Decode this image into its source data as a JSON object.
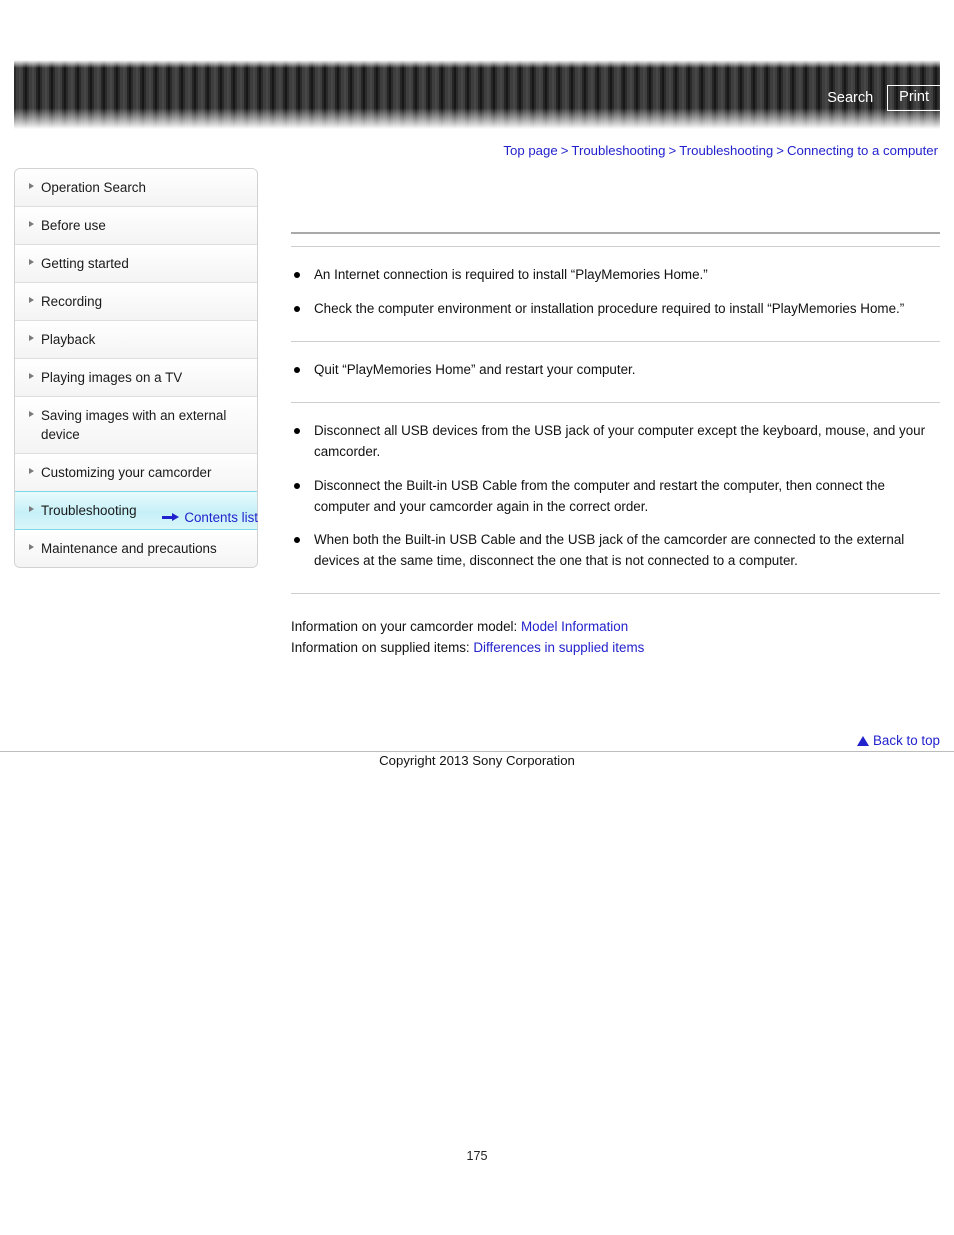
{
  "header": {
    "search_label": "Search",
    "print_label": "Print",
    "search_icon": "search-icon",
    "print_icon": "print-icon"
  },
  "breadcrumb": {
    "separator": ">",
    "items": [
      {
        "label": "Top page"
      },
      {
        "label": "Troubleshooting"
      },
      {
        "label": "Troubleshooting"
      },
      {
        "label": "Connecting to a computer"
      }
    ]
  },
  "sidebar": {
    "items": [
      {
        "label": "Operation Search",
        "active": false
      },
      {
        "label": "Before use",
        "active": false
      },
      {
        "label": "Getting started",
        "active": false
      },
      {
        "label": "Recording",
        "active": false
      },
      {
        "label": "Playback",
        "active": false
      },
      {
        "label": "Playing images on a TV",
        "active": false
      },
      {
        "label": "Saving images with an external device",
        "active": false
      },
      {
        "label": "Customizing your camcorder",
        "active": false
      },
      {
        "label": "Troubleshooting",
        "active": true
      },
      {
        "label": "Maintenance and precautions",
        "active": false
      }
    ],
    "contents_list_label": "Contents list",
    "contents_list_icon": "arrow-right-icon"
  },
  "main": {
    "page_heading": "",
    "sections": [
      {
        "title": "",
        "bullets": [
          "An Internet connection is required to install “PlayMemories Home.”",
          "Check the computer environment or installation procedure required to install “PlayMemories Home.”"
        ]
      },
      {
        "title": "",
        "bullets": [
          "Quit “PlayMemories Home” and restart your computer."
        ]
      },
      {
        "title": "",
        "bullets": [
          "Disconnect all USB devices from the USB jack of your computer except the keyboard, mouse, and your camcorder.",
          "Disconnect the Built-in USB Cable from the computer and restart the computer, then connect the computer and your camcorder again in the correct order.",
          "When both the Built-in USB Cable and the USB jack of the camcorder are connected to the external devices at the same time, disconnect the one that is not connected to a computer."
        ]
      }
    ],
    "info": {
      "model_prefix": "Information on your camcorder model: ",
      "model_link": "Model Information",
      "supplied_prefix": "Information on supplied items: ",
      "supplied_link": "Differences in supplied items"
    }
  },
  "footer": {
    "back_to_top_label": "Back to top",
    "back_to_top_icon": "triangle-up-icon",
    "copyright": "Copyright 2013 Sony Corporation",
    "page_number": "175"
  },
  "colors": {
    "link": "#2222cc",
    "active_nav_start": "#e8fbfd",
    "active_nav_end": "#c6f0f7",
    "active_nav_border": "#7fd8e8",
    "header_dark": "#2b2b2b",
    "header_light": "#474747",
    "rule_strong": "#a9a9a9",
    "rule_light": "#cfcfcf"
  }
}
